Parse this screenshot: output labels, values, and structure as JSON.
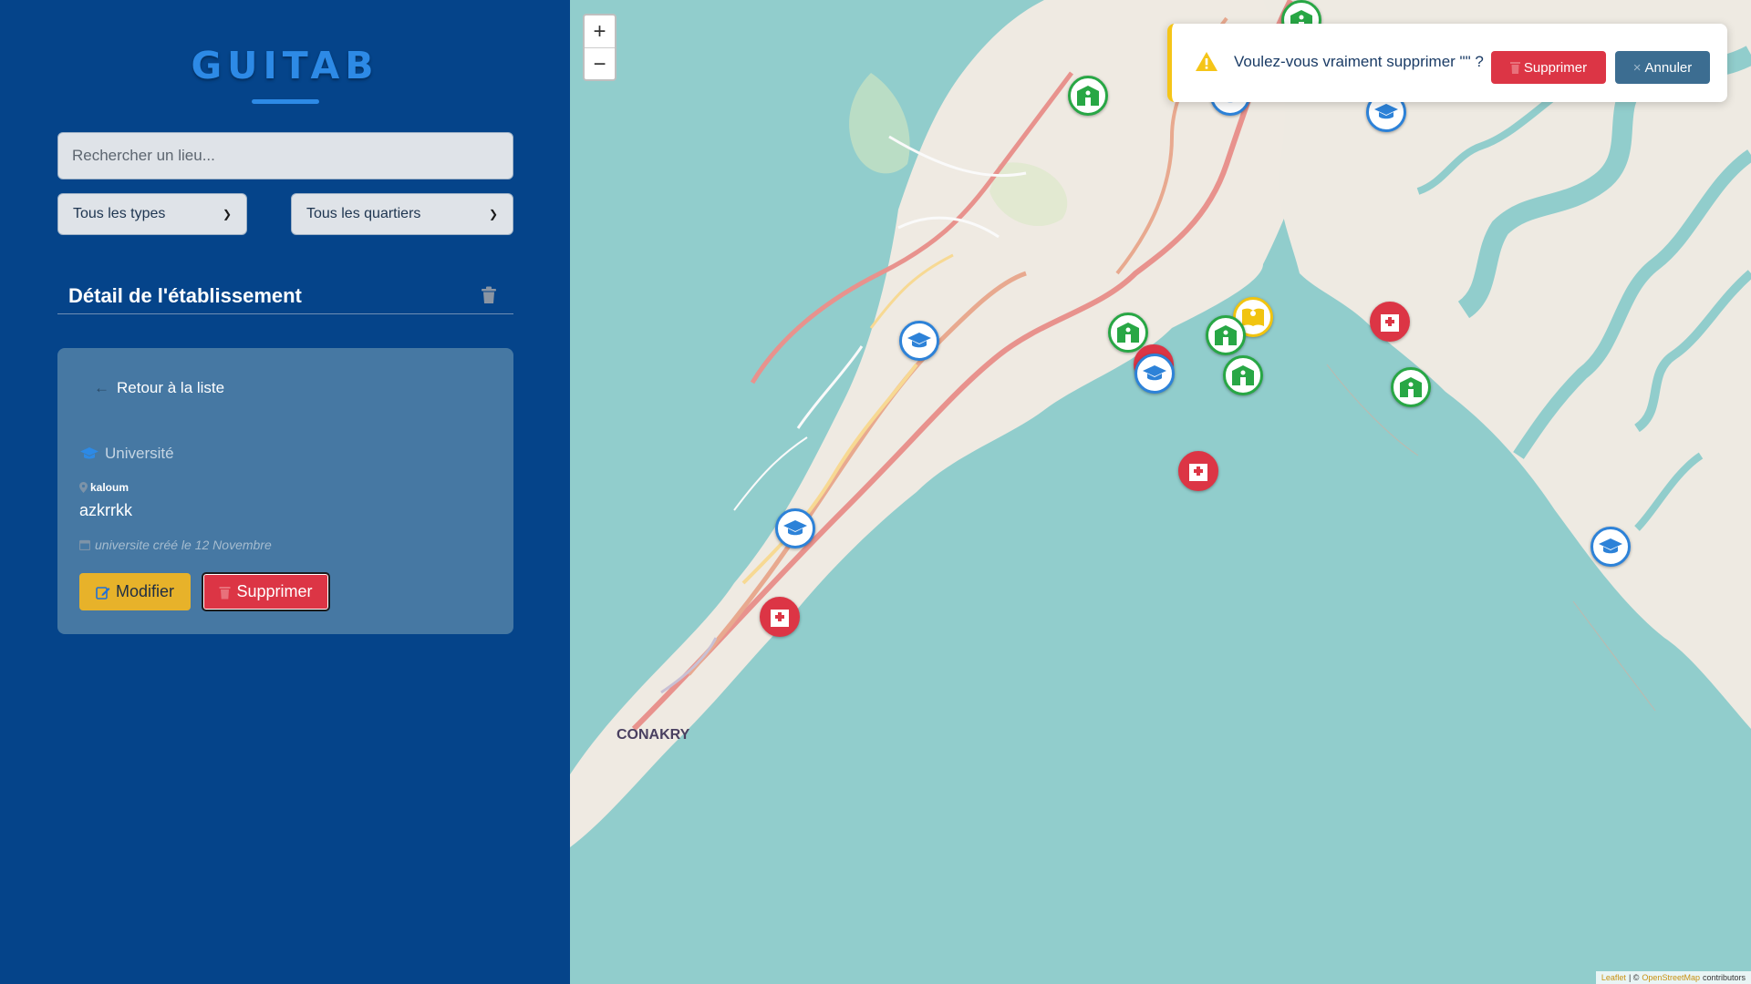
{
  "app": {
    "logo": "GUITAB"
  },
  "search": {
    "placeholder": "Rechercher un lieu..."
  },
  "filters": {
    "type": "Tous les types",
    "quartier": "Tous les quartiers"
  },
  "detail": {
    "title": "Détail de l'établissement",
    "back": "Retour à la liste",
    "type": "Université",
    "location": "kaloum",
    "name": "azkrrkk",
    "created": "universite créé le 12 Novembre",
    "edit": "Modifier",
    "delete": "Supprimer"
  },
  "toast": {
    "message": "Voulez-vous vraiment supprimer \"\" ?",
    "confirm": "Supprimer",
    "cancel": "Annuler"
  },
  "map": {
    "zoom_in": "+",
    "zoom_out": "−",
    "label": "CONAKRY",
    "attribution": {
      "leaflet": "Leaflet",
      "sep": "| ©",
      "osm": "OpenStreetMap",
      "contrib": "contributors"
    }
  },
  "colors": {
    "sidebar": "#05448a",
    "accent": "#2d8ae6",
    "edit": "#e7b22a",
    "danger": "#dc3545",
    "hospital": "#dc3545",
    "school": "#28a745",
    "university": "#2d82d8",
    "library": "#f1c40f"
  }
}
